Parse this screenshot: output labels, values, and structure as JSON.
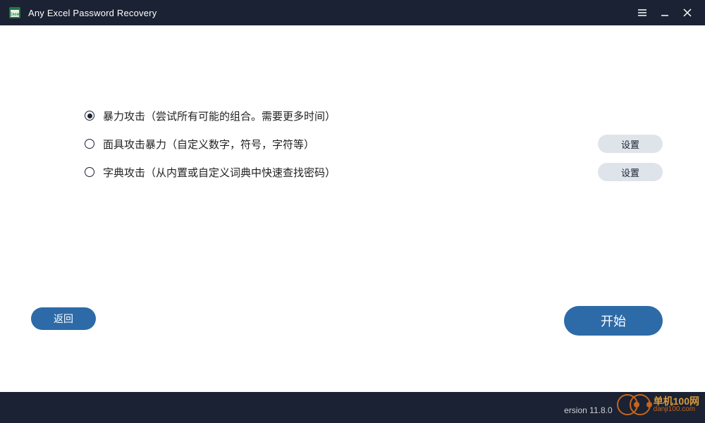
{
  "titlebar": {
    "title": "Any Excel Password Recovery"
  },
  "options": [
    {
      "label": "暴力攻击（尝试所有可能的组合。需要更多时间）",
      "selected": true,
      "has_settings": false
    },
    {
      "label": "面具攻击暴力（自定义数字，符号，字符等）",
      "selected": false,
      "has_settings": true
    },
    {
      "label": "字典攻击（从内置或自定义词典中快速查找密码）",
      "selected": false,
      "has_settings": true
    }
  ],
  "buttons": {
    "settings": "设置",
    "back": "返回",
    "start": "开始"
  },
  "footer": {
    "version": "ersion 11.8.0",
    "watermark_line1": "单机100网",
    "watermark_line2": "danji100.com"
  }
}
